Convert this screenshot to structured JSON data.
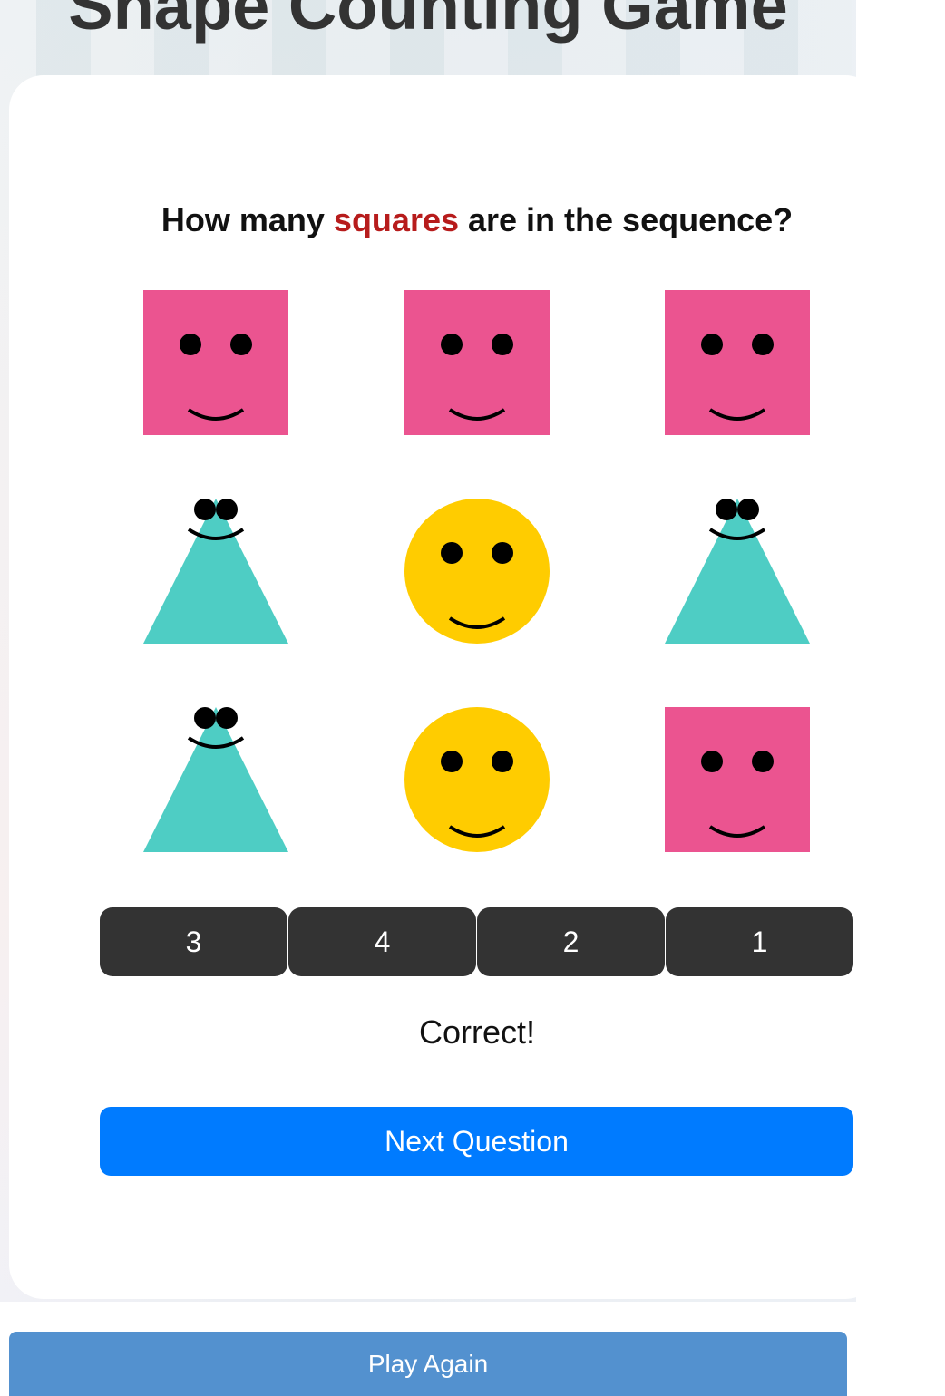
{
  "header": {
    "title": "Shape Counting Game"
  },
  "question": {
    "prefix": "How many ",
    "target": "squares",
    "suffix": " are in the sequence?"
  },
  "colors": {
    "square": "#eb5490",
    "triangle": "#4ecdc4",
    "circle": "#ffcc00",
    "target_word": "#b71c1c",
    "answer_button": "#333333",
    "next_button": "#007bff",
    "play_again_button": "#5391cf"
  },
  "grid": [
    [
      "square",
      "square",
      "square"
    ],
    [
      "triangle",
      "circle",
      "triangle"
    ],
    [
      "triangle",
      "circle",
      "square"
    ]
  ],
  "answers": [
    "3",
    "4",
    "2",
    "1"
  ],
  "result_text": "Correct!",
  "next_button_label": "Next Question",
  "play_again_label": "Play Again"
}
